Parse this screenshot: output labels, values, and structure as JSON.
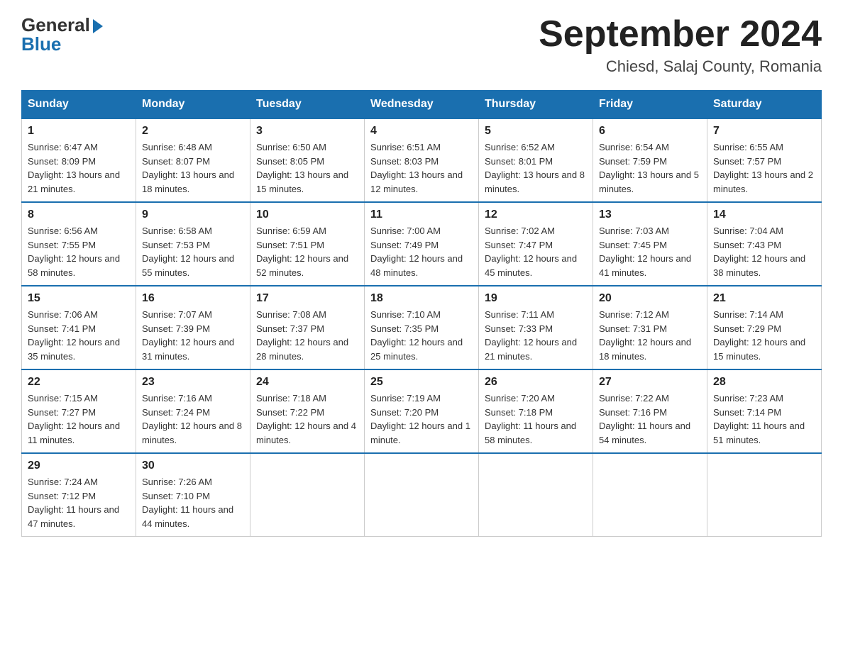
{
  "logo": {
    "general": "General",
    "blue": "Blue"
  },
  "header": {
    "title": "September 2024",
    "subtitle": "Chiesd, Salaj County, Romania"
  },
  "days_of_week": [
    "Sunday",
    "Monday",
    "Tuesday",
    "Wednesday",
    "Thursday",
    "Friday",
    "Saturday"
  ],
  "weeks": [
    [
      {
        "num": "1",
        "sunrise": "6:47 AM",
        "sunset": "8:09 PM",
        "daylight": "13 hours and 21 minutes."
      },
      {
        "num": "2",
        "sunrise": "6:48 AM",
        "sunset": "8:07 PM",
        "daylight": "13 hours and 18 minutes."
      },
      {
        "num": "3",
        "sunrise": "6:50 AM",
        "sunset": "8:05 PM",
        "daylight": "13 hours and 15 minutes."
      },
      {
        "num": "4",
        "sunrise": "6:51 AM",
        "sunset": "8:03 PM",
        "daylight": "13 hours and 12 minutes."
      },
      {
        "num": "5",
        "sunrise": "6:52 AM",
        "sunset": "8:01 PM",
        "daylight": "13 hours and 8 minutes."
      },
      {
        "num": "6",
        "sunrise": "6:54 AM",
        "sunset": "7:59 PM",
        "daylight": "13 hours and 5 minutes."
      },
      {
        "num": "7",
        "sunrise": "6:55 AM",
        "sunset": "7:57 PM",
        "daylight": "13 hours and 2 minutes."
      }
    ],
    [
      {
        "num": "8",
        "sunrise": "6:56 AM",
        "sunset": "7:55 PM",
        "daylight": "12 hours and 58 minutes."
      },
      {
        "num": "9",
        "sunrise": "6:58 AM",
        "sunset": "7:53 PM",
        "daylight": "12 hours and 55 minutes."
      },
      {
        "num": "10",
        "sunrise": "6:59 AM",
        "sunset": "7:51 PM",
        "daylight": "12 hours and 52 minutes."
      },
      {
        "num": "11",
        "sunrise": "7:00 AM",
        "sunset": "7:49 PM",
        "daylight": "12 hours and 48 minutes."
      },
      {
        "num": "12",
        "sunrise": "7:02 AM",
        "sunset": "7:47 PM",
        "daylight": "12 hours and 45 minutes."
      },
      {
        "num": "13",
        "sunrise": "7:03 AM",
        "sunset": "7:45 PM",
        "daylight": "12 hours and 41 minutes."
      },
      {
        "num": "14",
        "sunrise": "7:04 AM",
        "sunset": "7:43 PM",
        "daylight": "12 hours and 38 minutes."
      }
    ],
    [
      {
        "num": "15",
        "sunrise": "7:06 AM",
        "sunset": "7:41 PM",
        "daylight": "12 hours and 35 minutes."
      },
      {
        "num": "16",
        "sunrise": "7:07 AM",
        "sunset": "7:39 PM",
        "daylight": "12 hours and 31 minutes."
      },
      {
        "num": "17",
        "sunrise": "7:08 AM",
        "sunset": "7:37 PM",
        "daylight": "12 hours and 28 minutes."
      },
      {
        "num": "18",
        "sunrise": "7:10 AM",
        "sunset": "7:35 PM",
        "daylight": "12 hours and 25 minutes."
      },
      {
        "num": "19",
        "sunrise": "7:11 AM",
        "sunset": "7:33 PM",
        "daylight": "12 hours and 21 minutes."
      },
      {
        "num": "20",
        "sunrise": "7:12 AM",
        "sunset": "7:31 PM",
        "daylight": "12 hours and 18 minutes."
      },
      {
        "num": "21",
        "sunrise": "7:14 AM",
        "sunset": "7:29 PM",
        "daylight": "12 hours and 15 minutes."
      }
    ],
    [
      {
        "num": "22",
        "sunrise": "7:15 AM",
        "sunset": "7:27 PM",
        "daylight": "12 hours and 11 minutes."
      },
      {
        "num": "23",
        "sunrise": "7:16 AM",
        "sunset": "7:24 PM",
        "daylight": "12 hours and 8 minutes."
      },
      {
        "num": "24",
        "sunrise": "7:18 AM",
        "sunset": "7:22 PM",
        "daylight": "12 hours and 4 minutes."
      },
      {
        "num": "25",
        "sunrise": "7:19 AM",
        "sunset": "7:20 PM",
        "daylight": "12 hours and 1 minute."
      },
      {
        "num": "26",
        "sunrise": "7:20 AM",
        "sunset": "7:18 PM",
        "daylight": "11 hours and 58 minutes."
      },
      {
        "num": "27",
        "sunrise": "7:22 AM",
        "sunset": "7:16 PM",
        "daylight": "11 hours and 54 minutes."
      },
      {
        "num": "28",
        "sunrise": "7:23 AM",
        "sunset": "7:14 PM",
        "daylight": "11 hours and 51 minutes."
      }
    ],
    [
      {
        "num": "29",
        "sunrise": "7:24 AM",
        "sunset": "7:12 PM",
        "daylight": "11 hours and 47 minutes."
      },
      {
        "num": "30",
        "sunrise": "7:26 AM",
        "sunset": "7:10 PM",
        "daylight": "11 hours and 44 minutes."
      },
      null,
      null,
      null,
      null,
      null
    ]
  ]
}
